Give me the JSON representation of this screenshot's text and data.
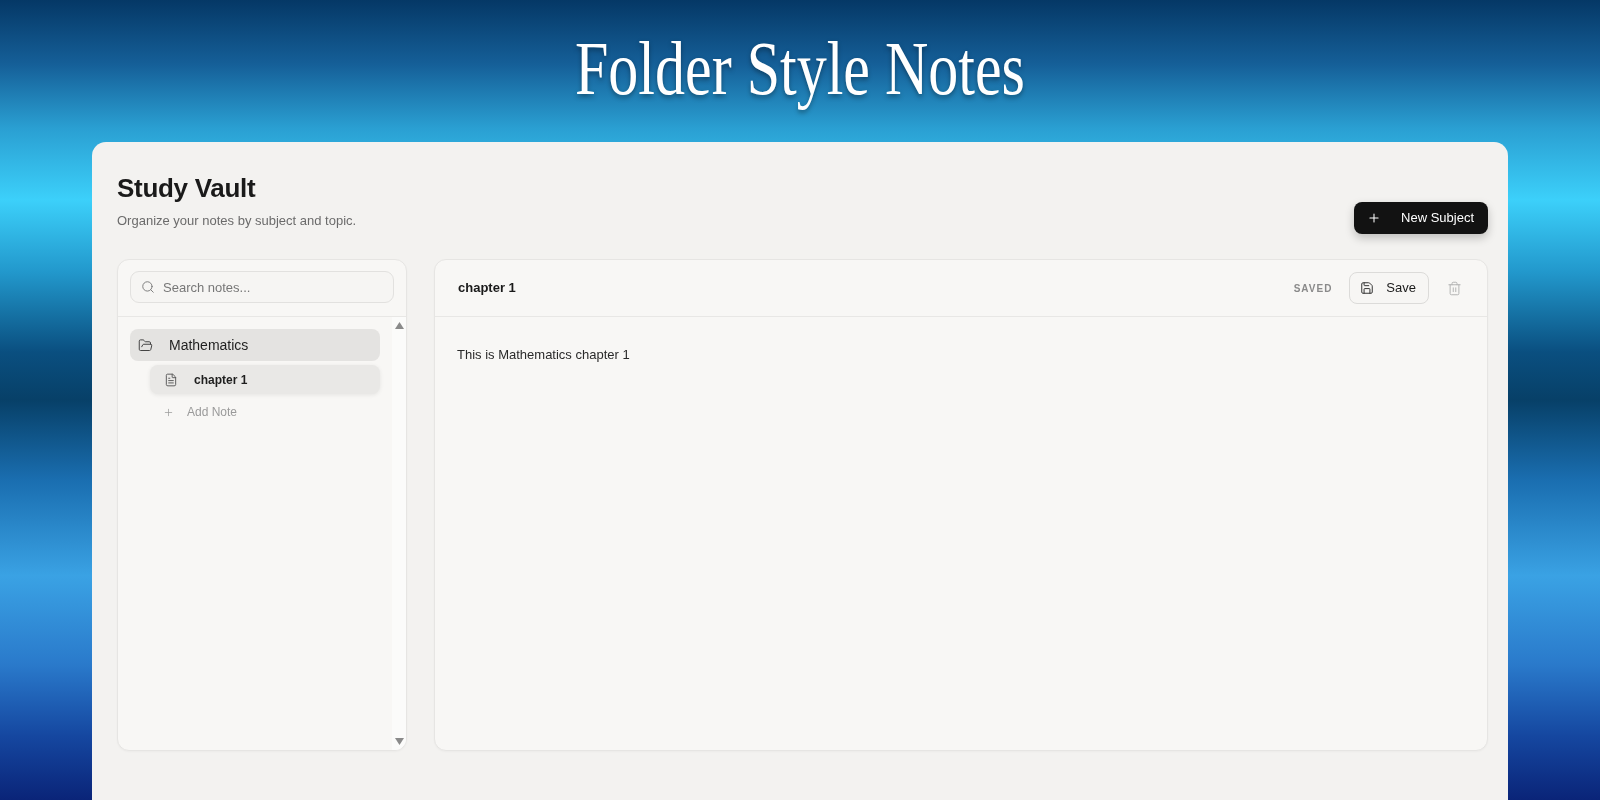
{
  "banner": {
    "title": "Folder Style Notes"
  },
  "header": {
    "title": "Study Vault",
    "subtitle": "Organize your notes by subject and topic.",
    "new_subject_button": "New Subject"
  },
  "sidebar": {
    "search": {
      "placeholder": "Search notes..."
    },
    "tree": [
      {
        "kind": "folder",
        "label": "Mathematics",
        "selected": true,
        "expanded": true,
        "add_note": "Add Note",
        "children": [
          {
            "kind": "note",
            "label": "chapter 1",
            "selected": true
          }
        ]
      }
    ]
  },
  "editor": {
    "title": "chapter 1",
    "status": "SAVED",
    "save_button": "Save",
    "body": "This is Mathematics chapter 1"
  }
}
